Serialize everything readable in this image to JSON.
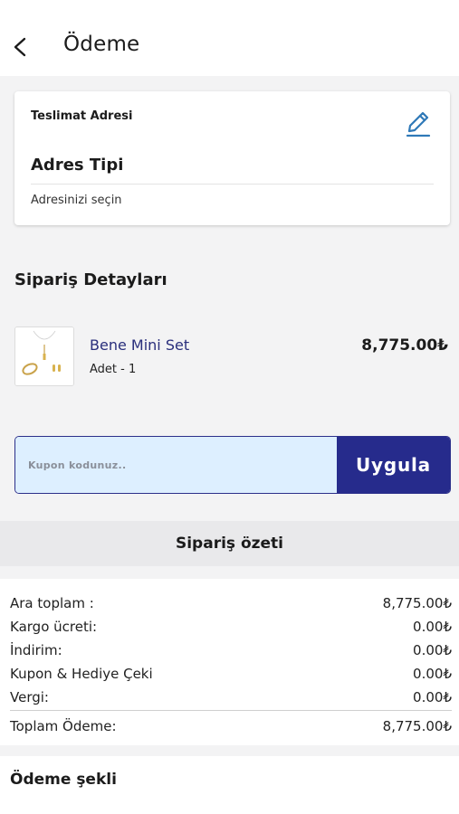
{
  "header": {
    "title": "Ödeme",
    "back_icon": "chevron-left-icon"
  },
  "address": {
    "section_label": "Teslimat Adresi",
    "type_label": "Adres Tipi",
    "select_prompt": "Adresinizi seçin",
    "edit_icon": "pencil-icon",
    "accent": "#2f79b8"
  },
  "order_details": {
    "title": "Sipariş Detayları",
    "items": [
      {
        "name": "Bene Mini Set",
        "qty_label": "Adet - 1",
        "price": "8,775.00₺"
      }
    ]
  },
  "coupon": {
    "placeholder": "Kupon kodunuz..",
    "value": "",
    "apply_label": "Uygula",
    "button_color": "#262b8c"
  },
  "summary": {
    "title": "Sipariş özeti",
    "rows": [
      {
        "label": "Ara toplam :",
        "value": "8,775.00₺"
      },
      {
        "label": "Kargo ücreti:",
        "value": "0.00₺"
      },
      {
        "label": "İndirim:",
        "value": "0.00₺"
      },
      {
        "label": "Kupon & Hediye Çeki",
        "value": "0.00₺"
      },
      {
        "label": "Vergi:",
        "value": "0.00₺"
      }
    ],
    "total": {
      "label": "Toplam Ödeme:",
      "value": "8,775.00₺"
    }
  },
  "payment": {
    "title": "Ödeme şekli"
  }
}
